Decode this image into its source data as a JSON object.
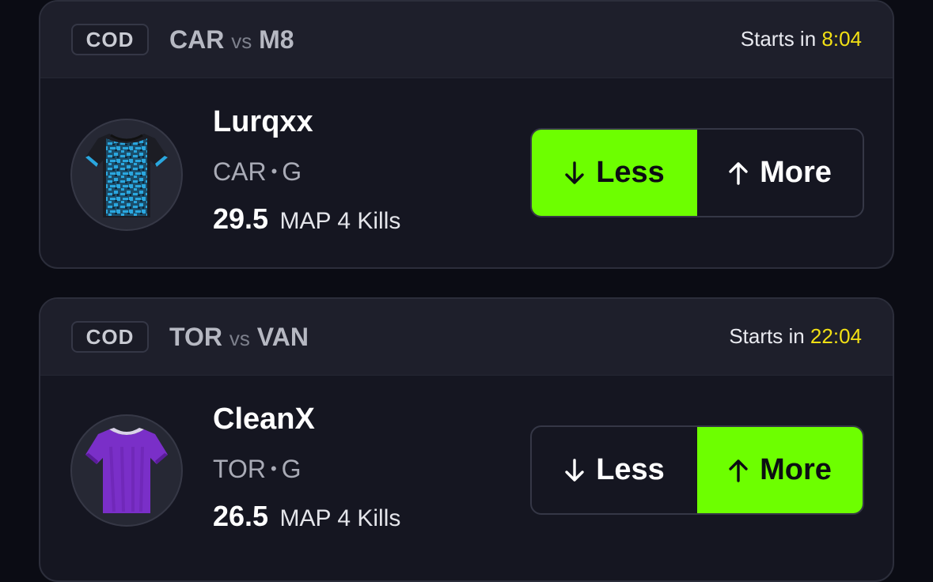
{
  "cards": [
    {
      "league": "COD",
      "team_home": "CAR",
      "vs": "vs",
      "team_away": "M8",
      "starts_label": "Starts in",
      "starts_time": "8:04",
      "player_name": "Lurqxx",
      "player_team": "CAR",
      "player_pos": "G",
      "line_value": "29.5",
      "stat_type": "MAP 4 Kills",
      "jersey_icon": "jersey-blue-camo-icon",
      "less_label": "Less",
      "more_label": "More",
      "selected": "less"
    },
    {
      "league": "COD",
      "team_home": "TOR",
      "vs": "vs",
      "team_away": "VAN",
      "starts_label": "Starts in",
      "starts_time": "22:04",
      "player_name": "CleanX",
      "player_team": "TOR",
      "player_pos": "G",
      "line_value": "26.5",
      "stat_type": "MAP 4 Kills",
      "jersey_icon": "jersey-purple-icon",
      "less_label": "Less",
      "more_label": "More",
      "selected": "more"
    }
  ],
  "colors": {
    "selected_green": "#6dff00",
    "countdown_yellow": "#f2e014",
    "card_bg": "#151621",
    "header_bg": "#1e1f2b"
  }
}
